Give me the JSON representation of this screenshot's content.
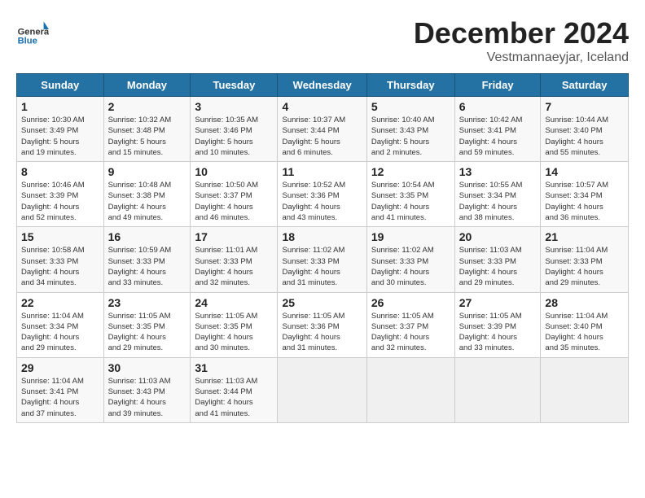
{
  "logo": {
    "text_general": "General",
    "text_blue": "Blue"
  },
  "title": "December 2024",
  "subtitle": "Vestmannaeyjar, Iceland",
  "days_of_week": [
    "Sunday",
    "Monday",
    "Tuesday",
    "Wednesday",
    "Thursday",
    "Friday",
    "Saturday"
  ],
  "weeks": [
    [
      {
        "day": "1",
        "info": "Sunrise: 10:30 AM\nSunset: 3:49 PM\nDaylight: 5 hours\nand 19 minutes."
      },
      {
        "day": "2",
        "info": "Sunrise: 10:32 AM\nSunset: 3:48 PM\nDaylight: 5 hours\nand 15 minutes."
      },
      {
        "day": "3",
        "info": "Sunrise: 10:35 AM\nSunset: 3:46 PM\nDaylight: 5 hours\nand 10 minutes."
      },
      {
        "day": "4",
        "info": "Sunrise: 10:37 AM\nSunset: 3:44 PM\nDaylight: 5 hours\nand 6 minutes."
      },
      {
        "day": "5",
        "info": "Sunrise: 10:40 AM\nSunset: 3:43 PM\nDaylight: 5 hours\nand 2 minutes."
      },
      {
        "day": "6",
        "info": "Sunrise: 10:42 AM\nSunset: 3:41 PM\nDaylight: 4 hours\nand 59 minutes."
      },
      {
        "day": "7",
        "info": "Sunrise: 10:44 AM\nSunset: 3:40 PM\nDaylight: 4 hours\nand 55 minutes."
      }
    ],
    [
      {
        "day": "8",
        "info": "Sunrise: 10:46 AM\nSunset: 3:39 PM\nDaylight: 4 hours\nand 52 minutes."
      },
      {
        "day": "9",
        "info": "Sunrise: 10:48 AM\nSunset: 3:38 PM\nDaylight: 4 hours\nand 49 minutes."
      },
      {
        "day": "10",
        "info": "Sunrise: 10:50 AM\nSunset: 3:37 PM\nDaylight: 4 hours\nand 46 minutes."
      },
      {
        "day": "11",
        "info": "Sunrise: 10:52 AM\nSunset: 3:36 PM\nDaylight: 4 hours\nand 43 minutes."
      },
      {
        "day": "12",
        "info": "Sunrise: 10:54 AM\nSunset: 3:35 PM\nDaylight: 4 hours\nand 41 minutes."
      },
      {
        "day": "13",
        "info": "Sunrise: 10:55 AM\nSunset: 3:34 PM\nDaylight: 4 hours\nand 38 minutes."
      },
      {
        "day": "14",
        "info": "Sunrise: 10:57 AM\nSunset: 3:34 PM\nDaylight: 4 hours\nand 36 minutes."
      }
    ],
    [
      {
        "day": "15",
        "info": "Sunrise: 10:58 AM\nSunset: 3:33 PM\nDaylight: 4 hours\nand 34 minutes."
      },
      {
        "day": "16",
        "info": "Sunrise: 10:59 AM\nSunset: 3:33 PM\nDaylight: 4 hours\nand 33 minutes."
      },
      {
        "day": "17",
        "info": "Sunrise: 11:01 AM\nSunset: 3:33 PM\nDaylight: 4 hours\nand 32 minutes."
      },
      {
        "day": "18",
        "info": "Sunrise: 11:02 AM\nSunset: 3:33 PM\nDaylight: 4 hours\nand 31 minutes."
      },
      {
        "day": "19",
        "info": "Sunrise: 11:02 AM\nSunset: 3:33 PM\nDaylight: 4 hours\nand 30 minutes."
      },
      {
        "day": "20",
        "info": "Sunrise: 11:03 AM\nSunset: 3:33 PM\nDaylight: 4 hours\nand 29 minutes."
      },
      {
        "day": "21",
        "info": "Sunrise: 11:04 AM\nSunset: 3:33 PM\nDaylight: 4 hours\nand 29 minutes."
      }
    ],
    [
      {
        "day": "22",
        "info": "Sunrise: 11:04 AM\nSunset: 3:34 PM\nDaylight: 4 hours\nand 29 minutes."
      },
      {
        "day": "23",
        "info": "Sunrise: 11:05 AM\nSunset: 3:35 PM\nDaylight: 4 hours\nand 29 minutes."
      },
      {
        "day": "24",
        "info": "Sunrise: 11:05 AM\nSunset: 3:35 PM\nDaylight: 4 hours\nand 30 minutes."
      },
      {
        "day": "25",
        "info": "Sunrise: 11:05 AM\nSunset: 3:36 PM\nDaylight: 4 hours\nand 31 minutes."
      },
      {
        "day": "26",
        "info": "Sunrise: 11:05 AM\nSunset: 3:37 PM\nDaylight: 4 hours\nand 32 minutes."
      },
      {
        "day": "27",
        "info": "Sunrise: 11:05 AM\nSunset: 3:39 PM\nDaylight: 4 hours\nand 33 minutes."
      },
      {
        "day": "28",
        "info": "Sunrise: 11:04 AM\nSunset: 3:40 PM\nDaylight: 4 hours\nand 35 minutes."
      }
    ],
    [
      {
        "day": "29",
        "info": "Sunrise: 11:04 AM\nSunset: 3:41 PM\nDaylight: 4 hours\nand 37 minutes."
      },
      {
        "day": "30",
        "info": "Sunrise: 11:03 AM\nSunset: 3:43 PM\nDaylight: 4 hours\nand 39 minutes."
      },
      {
        "day": "31",
        "info": "Sunrise: 11:03 AM\nSunset: 3:44 PM\nDaylight: 4 hours\nand 41 minutes."
      },
      null,
      null,
      null,
      null
    ]
  ]
}
